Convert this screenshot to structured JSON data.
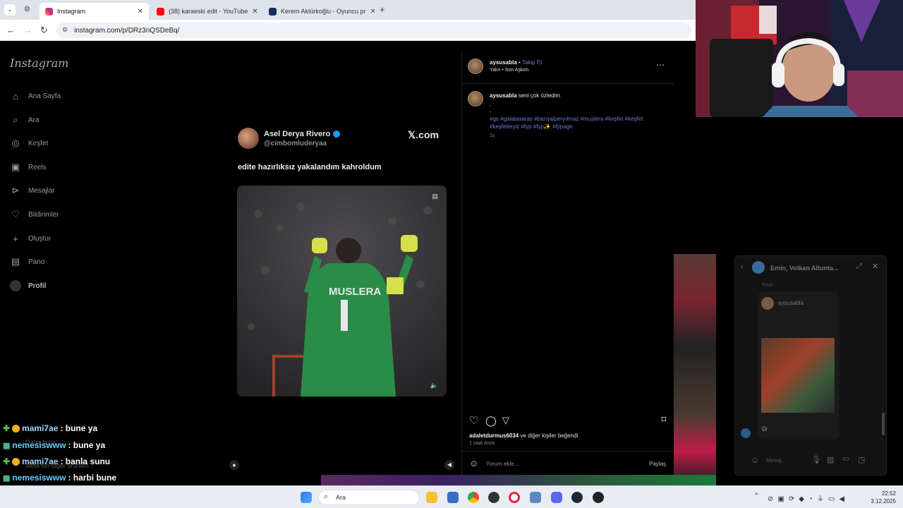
{
  "browser": {
    "tabs": [
      {
        "label": "Instagram",
        "active": true
      },
      {
        "label": "(38) karaeski edit - YouTube",
        "active": false
      },
      {
        "label": "Kerem Aktürkoğlu - Oyuncu pr",
        "active": false
      }
    ],
    "new_tab": "+",
    "url": "instagram.com/p/DRz3nQSDeBq/"
  },
  "instagram": {
    "logo": "Instagram",
    "nav": [
      {
        "label": "Ana Sayfa",
        "icon": "home-icon"
      },
      {
        "label": "Ara",
        "icon": "search-icon"
      },
      {
        "label": "Keşfet",
        "icon": "compass-icon"
      },
      {
        "label": "Reels",
        "icon": "reels-icon"
      },
      {
        "label": "Mesajlar",
        "icon": "send-icon"
      },
      {
        "label": "Bildirimler",
        "icon": "heart-icon"
      },
      {
        "label": "Oluştur",
        "icon": "plus-icon"
      },
      {
        "label": "Pano",
        "icon": "chart-icon"
      },
      {
        "label": "Profil",
        "icon": "profile-icon"
      }
    ],
    "more_labels": [
      "Daha fazla",
      "Meta'nın diğer ürünleri"
    ]
  },
  "post_media": {
    "tweet_name": "Asel Derya Rivero",
    "tweet_handle": "@cimbomluderyaa",
    "tweet_site": "𝕏.com",
    "tweet_text": "edite hazırlıksız yakalandım kahroldum",
    "jersey_text": "MUSLERA"
  },
  "post_panel": {
    "username": "aysusabla",
    "follow_label": "Takip Et",
    "audio": "Yalın • Son Aşkım",
    "caption_user": "aysusabla",
    "caption_text": "seni çok özledim",
    "caption_dots": [
      ".",
      "."
    ],
    "hashtags_line1": "#gs #galatasaray #barışalperyılmaz #muslera #keşfet #keşfet",
    "hashtags_line2": "#keşfetteyiz #fyp #fyp✨ #fypage",
    "caption_time": "1s",
    "likes_user": "adaletdurmus6034",
    "likes_text": "ve diğer kişiler beğendi",
    "post_time": "1 saat önce",
    "comment_placeholder": "Yorum ekle...",
    "share_label": "Paylaş"
  },
  "chat": [
    {
      "user": "mami7ae",
      "message": ": bune ya",
      "color": "#9fd7ff"
    },
    {
      "user": "nemesiswww",
      "message": ": bune ya",
      "color": "#66ccff"
    },
    {
      "user": "mami7ae",
      "message": ": banla sunu",
      "color": "#9fd7ff"
    },
    {
      "user": "nemesiswww",
      "message": ": harbi bune",
      "color": "#66ccff"
    }
  ],
  "dm_popup": {
    "title": "Emin, Volkan Altunta...",
    "sender": "Emin",
    "shared_user": "aysusabla",
    "message_placeholder": "Mesaj..."
  },
  "taskbar": {
    "search_label": "Ara",
    "time": "22:52",
    "date": "3.12.2025"
  }
}
